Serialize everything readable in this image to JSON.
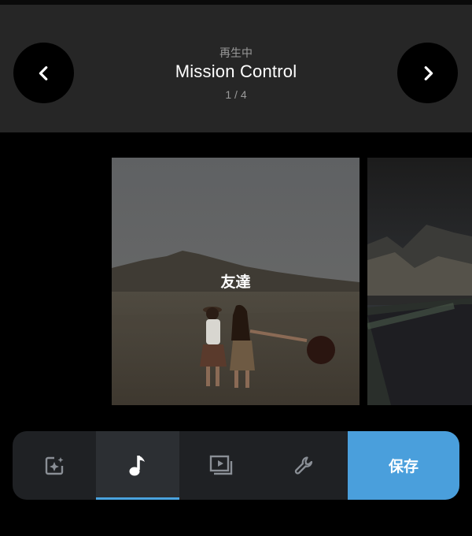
{
  "header": {
    "status": "再生中",
    "title": "Mission Control",
    "counter": "1 / 4"
  },
  "carousel": {
    "items": [
      {
        "label": "友達"
      },
      {
        "label": ""
      }
    ]
  },
  "toolbar": {
    "tools": [
      {
        "name": "sparkle-photo",
        "active": false
      },
      {
        "name": "music-note",
        "active": true
      },
      {
        "name": "video-clips",
        "active": false
      },
      {
        "name": "wrench",
        "active": false
      }
    ],
    "save_label": "保存"
  },
  "colors": {
    "header_bg": "#262626",
    "toolbar_bg": "#1f2124",
    "accent": "#4a9fdc"
  }
}
